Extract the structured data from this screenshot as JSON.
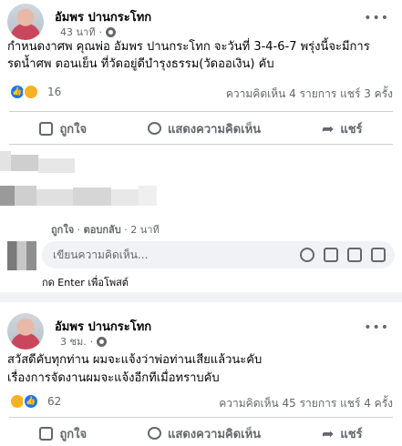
{
  "post1": {
    "author": "อัมพร ปานกระโทก",
    "time": "43 นาที",
    "text": "กำหนดงาศพ คุณพ่อ อัมพร ปานกระโทก จะวันที่ 3-4-6-7 พรุ่งนี้จะมีการรดน้ำศพ ตอนเย็น ที่วัดอยู่ดีบำรุงธรรม(วัดออเงิน) คับ",
    "reaction_count": "16",
    "stats_right": "ความคิดเห็น 4 รายการ  แชร์ 3 ครั้ง",
    "actions": {
      "like": "ถูกใจ",
      "comment": "แสดงความคิดเห็น",
      "share": "แชร์"
    },
    "comment_meta": {
      "like": "ถูกใจ",
      "reply": "ตอบกลับ",
      "time": "2 นาที"
    },
    "comment_input_placeholder": "เขียนความคิดเห็น...",
    "enter_hint": "กด Enter เพื่อโพสต์"
  },
  "post2": {
    "author": "อัมพร ปานกระโทก",
    "time": "3 ชม.",
    "line1": "สวัสดีคับทุกท่าน ผมจะแจ้งว่าพ่อท่านเสียแล้วนะคับ",
    "line2": "เรื่องการจัดงานผมจะแจ้งอีกทีเมื่อทราบคับ",
    "reaction_count": "62",
    "stats_right": "ความคิดเห็น 45 รายการ  แชร์ 4 ครั้ง",
    "actions": {
      "like": "ถูกใจ",
      "comment": "แสดงความคิดเห็น",
      "share": "แชร์"
    }
  },
  "colors": {
    "accent": "#1877f2",
    "muted": "#65676b",
    "background": "#f0f2f5"
  }
}
